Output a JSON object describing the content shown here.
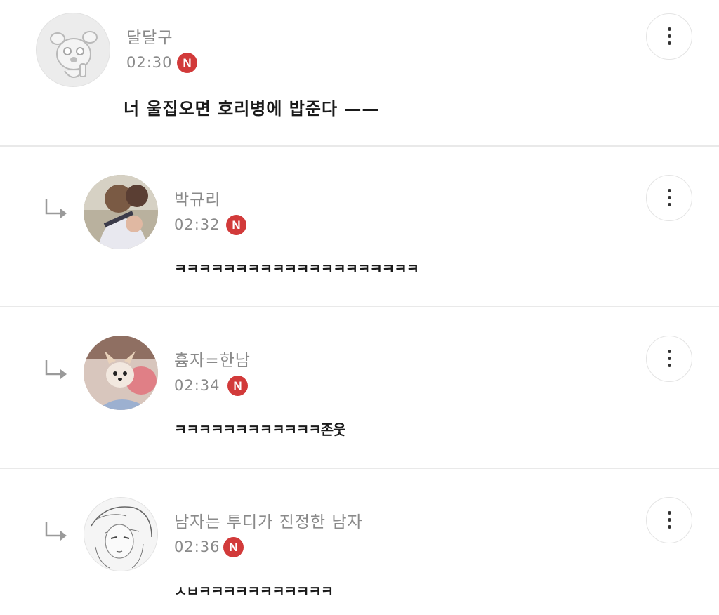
{
  "comments": [
    {
      "author": "달달구",
      "time": "02:30",
      "badge": "N",
      "text": "너 울집오면 호리병에 밥준다 ——",
      "avatar": "dog-cartoon-avatar",
      "is_reply": false
    },
    {
      "author": "박규리",
      "time": "02:32",
      "badge": "N",
      "text": "ㅋㅋㅋㅋㅋㅋㅋㅋㅋㅋㅋㅋㅋㅋㅋㅋㅋㅋㅋㅋ",
      "avatar": "people-photo-avatar",
      "is_reply": true
    },
    {
      "author": "흄자=한남",
      "time": "02:34",
      "badge": "N",
      "text": "ㅋㅋㅋㅋㅋㅋㅋㅋㅋㅋㅋㅋ존웃",
      "avatar": "chihuahua-photo-avatar",
      "is_reply": true
    },
    {
      "author": "남자는 투디가 진정한 남자",
      "time": "02:36",
      "badge": "N",
      "text": "ㅅㅂㅋㅋㅋㅋㅋㅋㅋㅋㅋㅋㅋ",
      "avatar": "anime-sketch-avatar",
      "is_reply": true
    }
  ],
  "icons": {
    "more": "more-vertical-icon",
    "reply": "reply-arrow-icon",
    "new_badge": "new-badge"
  },
  "colors": {
    "badge": "#d23a3a",
    "meta_text": "#8a8a8a",
    "body_text": "#1a1a1a",
    "divider": "#e9e9e9"
  }
}
